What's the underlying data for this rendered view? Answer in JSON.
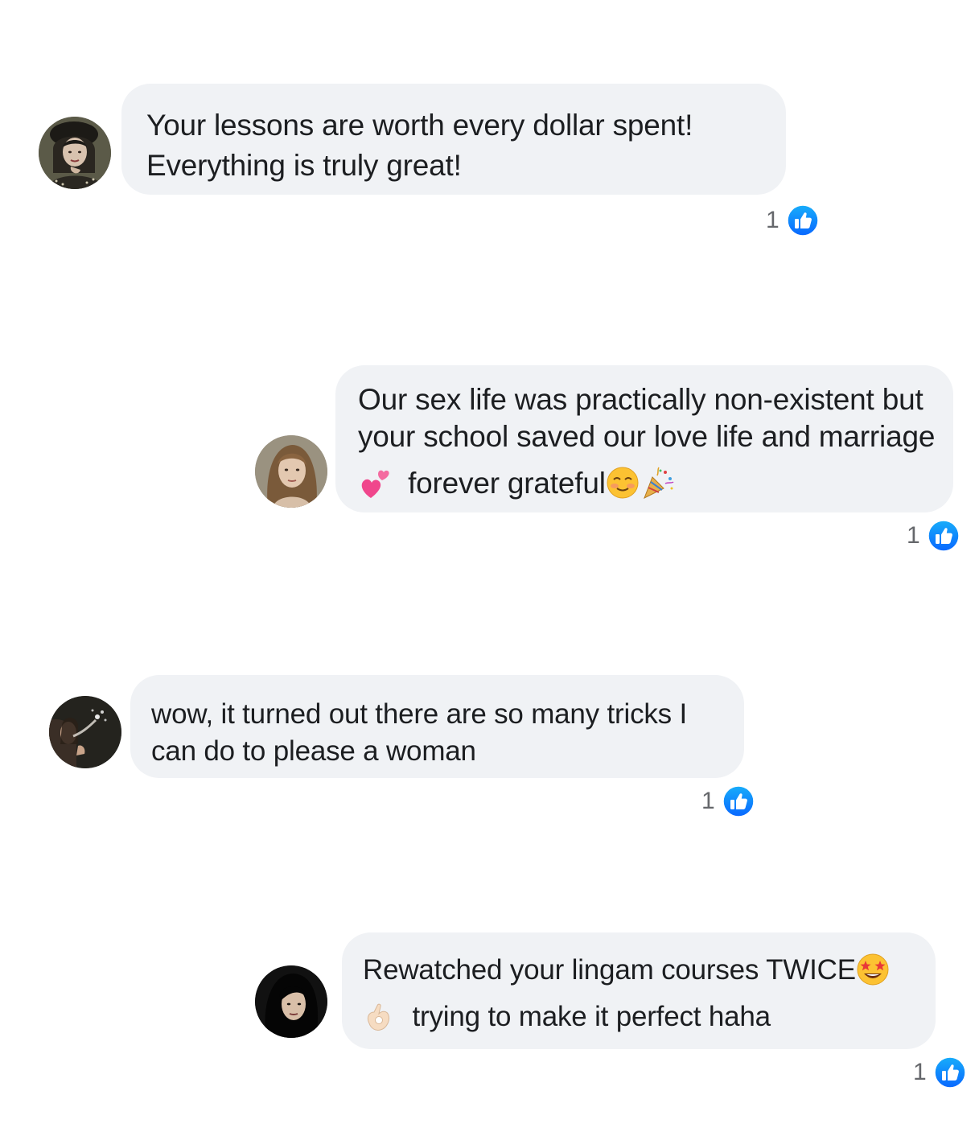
{
  "comments": [
    {
      "avatar_icon": "avatar-woman-dark-hair-icon",
      "lines": [
        "Your lessons are worth every dollar spent!",
        "Everything is truly great!"
      ],
      "reaction_count": "1",
      "reaction_icon": "like-icon"
    },
    {
      "avatar_icon": "avatar-woman-light-hair-icon",
      "lines": [
        "Our sex life was practically non-existent but",
        "your school saved our love life and marriage"
      ],
      "line3_text": "forever grateful",
      "line3_emojis": [
        "two-hearts-icon",
        "smiling-face-icon",
        "party-popper-icon"
      ],
      "reaction_count": "1",
      "reaction_icon": "like-icon"
    },
    {
      "avatar_icon": "avatar-person-smoke-icon",
      "lines": [
        "wow, it turned out there are so many tricks I",
        "can do to please a woman"
      ],
      "reaction_count": "1",
      "reaction_icon": "like-icon"
    },
    {
      "avatar_icon": "avatar-woman-black-hair-icon",
      "line1_text": "Rewatched your lingam courses TWICE",
      "line2_text": "trying to make it perfect haha",
      "emojis": [
        "star-struck-icon",
        "ok-hand-icon"
      ],
      "reaction_count": "1",
      "reaction_icon": "like-icon"
    }
  ],
  "colors": {
    "bubble": "#f0f2f5",
    "text": "#1c1e21",
    "like_blue": "#1877f2",
    "count_grey": "#65676b"
  }
}
